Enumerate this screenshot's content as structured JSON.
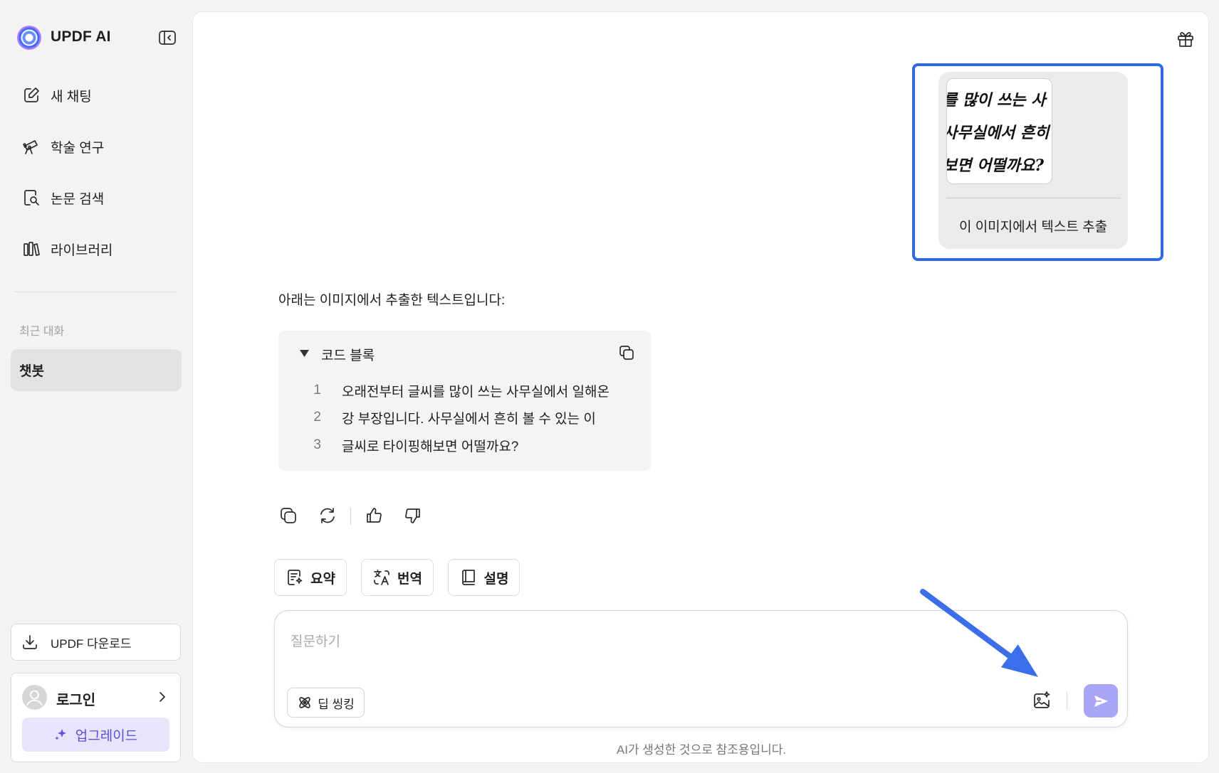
{
  "app": {
    "title": "UPDF AI"
  },
  "colors": {
    "accent": "#5a4fd8",
    "upgrade_bg": "#e7e4fc",
    "send_bg": "#a9a6f7",
    "highlight": "#2f6ae6",
    "arrow": "#3b6ee8"
  },
  "sidebar": {
    "nav": [
      {
        "label": "새 채팅",
        "icon": "edit-icon"
      },
      {
        "label": "학술 연구",
        "icon": "telescope-icon"
      },
      {
        "label": "논문 검색",
        "icon": "document-search-icon"
      },
      {
        "label": "라이브러리",
        "icon": "library-icon"
      }
    ],
    "recent_heading": "최근 대화",
    "recent": [
      {
        "label": "챗봇",
        "selected": true
      }
    ],
    "download_label": "UPDF 다운로드",
    "login_label": "로그인",
    "upgrade_label": "업그레이드"
  },
  "chat": {
    "user_message": {
      "image_lines": [
        "를 많이 쓰는 사",
        "사무실에서 흔히",
        "보면 어떨까요?"
      ],
      "text": "이 이미지에서 텍스트 추출"
    },
    "assistant": {
      "intro": "아래는 이미지에서 추출한 텍스트입니다:",
      "code_block": {
        "title": "코드 블록",
        "lines": [
          {
            "n": "1",
            "text": "오래전부터 글씨를 많이 쓰는 사무실에서 일해온"
          },
          {
            "n": "2",
            "text": "강 부장입니다. 사무실에서 흔히 볼 수 있는 이"
          },
          {
            "n": "3",
            "text": "글씨로 타이핑해보면 어떨까요?"
          }
        ]
      }
    }
  },
  "quick_actions": [
    {
      "label": "요약",
      "icon": "summary-icon"
    },
    {
      "label": "번역",
      "icon": "translate-icon"
    },
    {
      "label": "설명",
      "icon": "book-icon"
    }
  ],
  "composer": {
    "placeholder": "질문하기",
    "deep_thinking_label": "딥 씽킹"
  },
  "footer_note": "AI가 생성한 것으로 참조용입니다."
}
